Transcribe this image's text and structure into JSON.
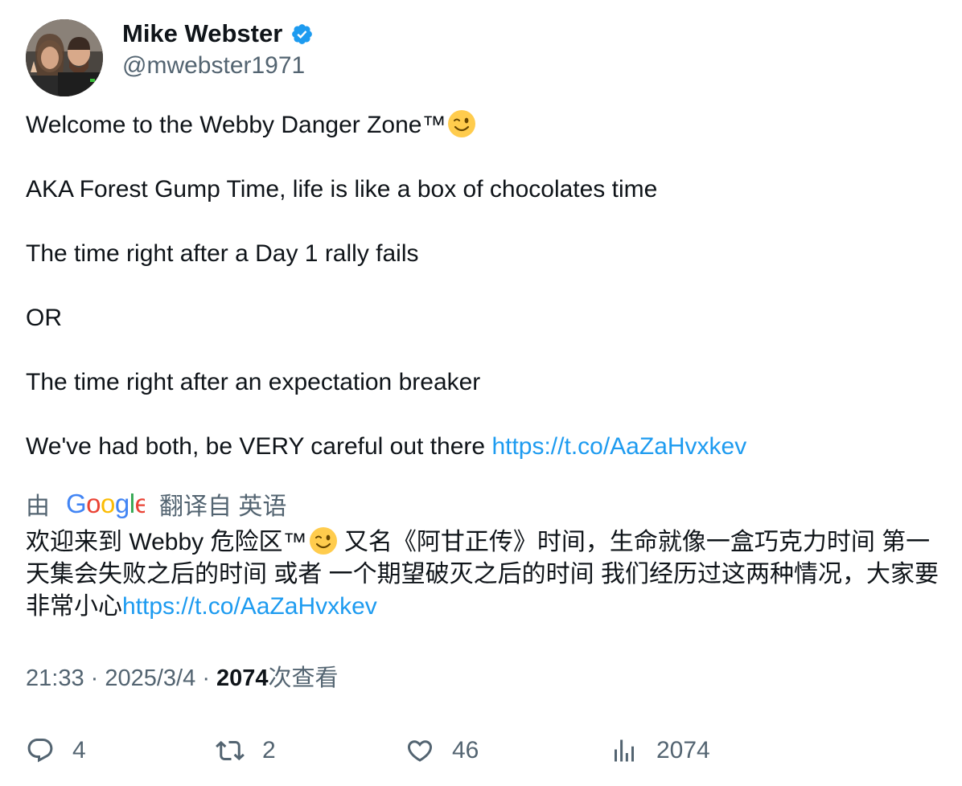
{
  "author": {
    "display_name": "Mike Webster",
    "handle": "@mwebster1971"
  },
  "tweet": {
    "lines": [
      "Welcome to the Webby Danger Zone™",
      "AKA Forest Gump Time, life is like a box of chocolates time",
      "The time right after a Day 1 rally fails",
      "OR",
      "The time right after an expectation breaker",
      "We've had both, be VERY careful out there "
    ],
    "link": "https://t.co/AaZaHvxkev"
  },
  "translation": {
    "by_label": "由",
    "provider": "Google",
    "from_label": "翻译自 英语",
    "text_part1": "欢迎来到 Webby 危险区™",
    "text_part2": " 又名《阿甘正传》时间，生命就像一盒巧克力时间 第一天集会失败之后的时间 或者 一个期望破灭之后的时间 我们经历过这两种情况，大家要非常小心",
    "link": "https://t.co/AaZaHvxkev"
  },
  "meta": {
    "time": "21:33",
    "date": "2025/3/4",
    "views_count": "2074",
    "views_label": "次查看"
  },
  "actions": {
    "replies": "4",
    "reposts": "2",
    "likes": "46",
    "views": "2074"
  },
  "colors": {
    "link": "#1d9bf0",
    "secondary": "#536471",
    "verified": "#1d9bf0"
  }
}
